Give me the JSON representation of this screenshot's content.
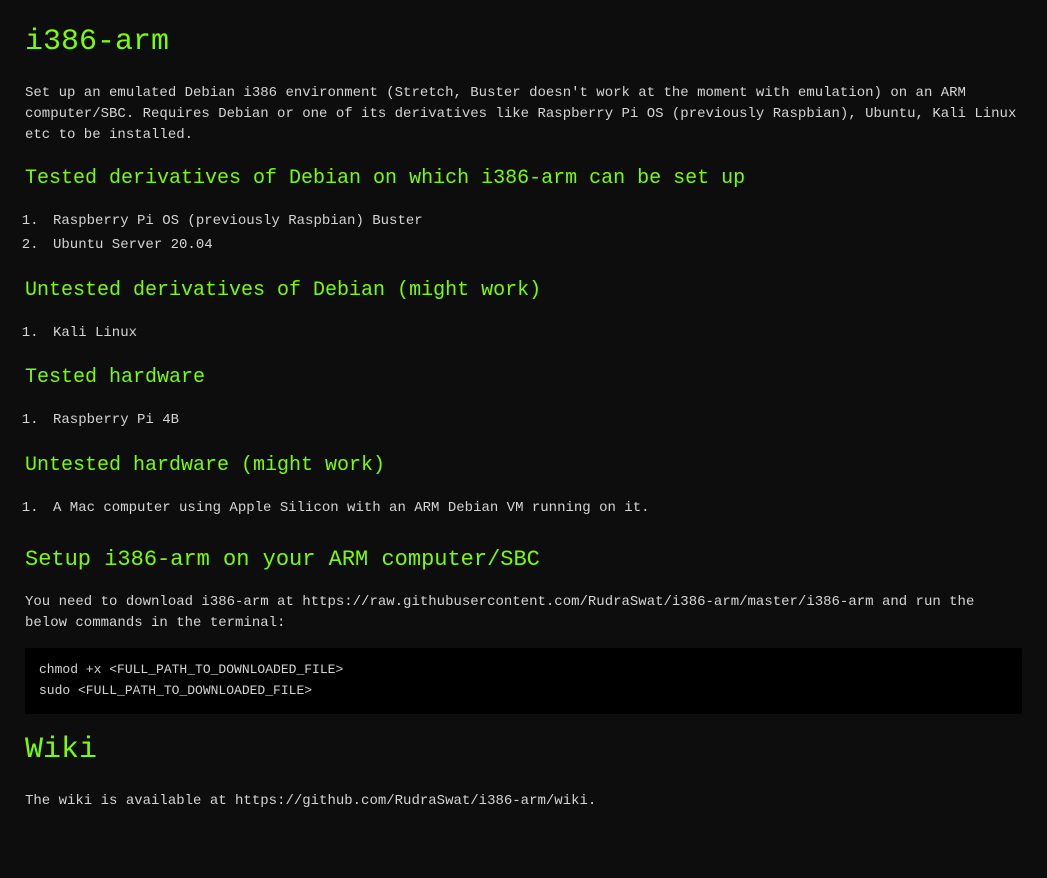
{
  "title": "i386-arm",
  "intro": "Set up an emulated Debian i386 environment (Stretch, Buster doesn't work at the moment with emulation) on an ARM computer/SBC. Requires Debian or one of its derivatives like Raspberry Pi OS (previously Raspbian), Ubuntu, Kali Linux etc to be installed.",
  "sections": {
    "tested_derivatives": {
      "heading": "Tested derivatives of Debian on which i386-arm can be set up",
      "items": [
        "Raspberry Pi OS (previously Raspbian) Buster",
        "Ubuntu Server 20.04"
      ]
    },
    "untested_derivatives": {
      "heading": "Untested derivatives of Debian (might work)",
      "items": [
        "Kali Linux"
      ]
    },
    "tested_hardware": {
      "heading": "Tested hardware",
      "items": [
        "Raspberry Pi 4B"
      ]
    },
    "untested_hardware": {
      "heading": "Untested hardware (might work)",
      "items": [
        "A Mac computer using Apple Silicon with an ARM Debian VM running on it."
      ]
    },
    "setup": {
      "heading": "Setup i386-arm on your ARM computer/SBC",
      "instructions": "You need to download i386-arm at https://raw.githubusercontent.com/RudraSwat/i386-arm/master/i386-arm and run the below commands in the terminal:",
      "code": "chmod +x <FULL_PATH_TO_DOWNLOADED_FILE>\nsudo <FULL_PATH_TO_DOWNLOADED_FILE>"
    },
    "wiki": {
      "heading": "Wiki",
      "text": "The wiki is available at https://github.com/RudraSwat/i386-arm/wiki."
    }
  }
}
